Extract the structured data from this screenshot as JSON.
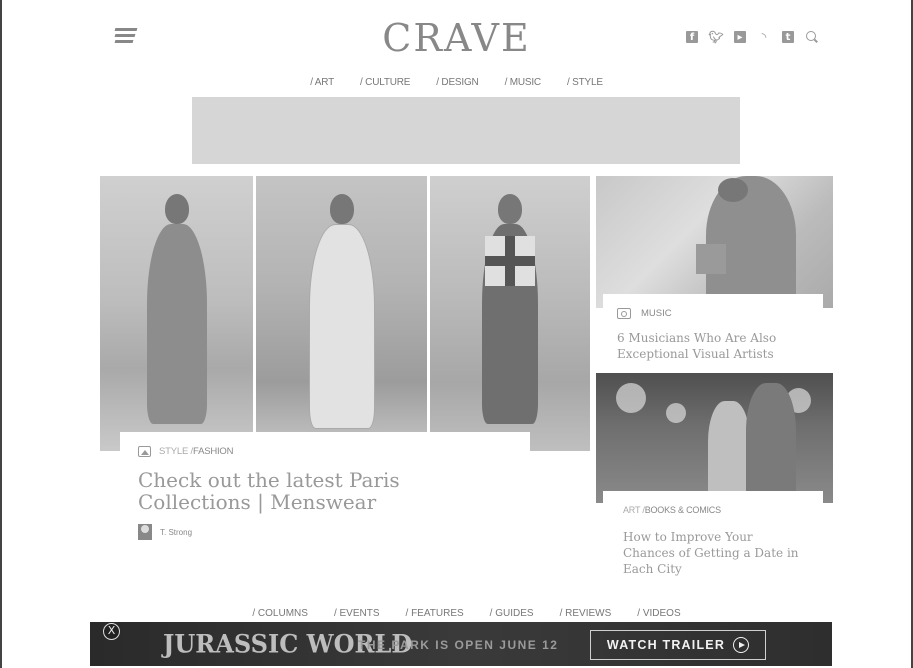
{
  "header": {
    "logo": "CRAVE",
    "socials": [
      "facebook-icon",
      "twitter-icon",
      "youtube-icon",
      "rss-icon",
      "tumblr-icon",
      "search-icon"
    ]
  },
  "topnav": [
    "/ ART",
    "/ CULTURE",
    "/ DESIGN",
    "/ MUSIC",
    "/ STYLE"
  ],
  "hero": {
    "category": "STYLE /",
    "subcategory": "FASHION",
    "title": "Check out the latest Paris Collections | Menswear",
    "author": "T. Strong"
  },
  "card1": {
    "category": "MUSIC",
    "title": "6 Musicians Who Are Also Exceptional Visual Artists"
  },
  "card2": {
    "category": "ART /",
    "subcategory": "BOOKS & COMICS",
    "title": "How to Improve Your Chances of Getting a Date in Each City"
  },
  "bottomnav": [
    "/ COLUMNS",
    "/ EVENTS",
    "/ FEATURES",
    "/ GUIDES",
    "/ REVIEWS",
    "/ VIDEOS"
  ],
  "banner": {
    "close": "X",
    "brand": "JURASSIC WORLD",
    "tagline": "THE PARK IS OPEN JUNE 12",
    "cta": "WATCH TRAILER"
  }
}
